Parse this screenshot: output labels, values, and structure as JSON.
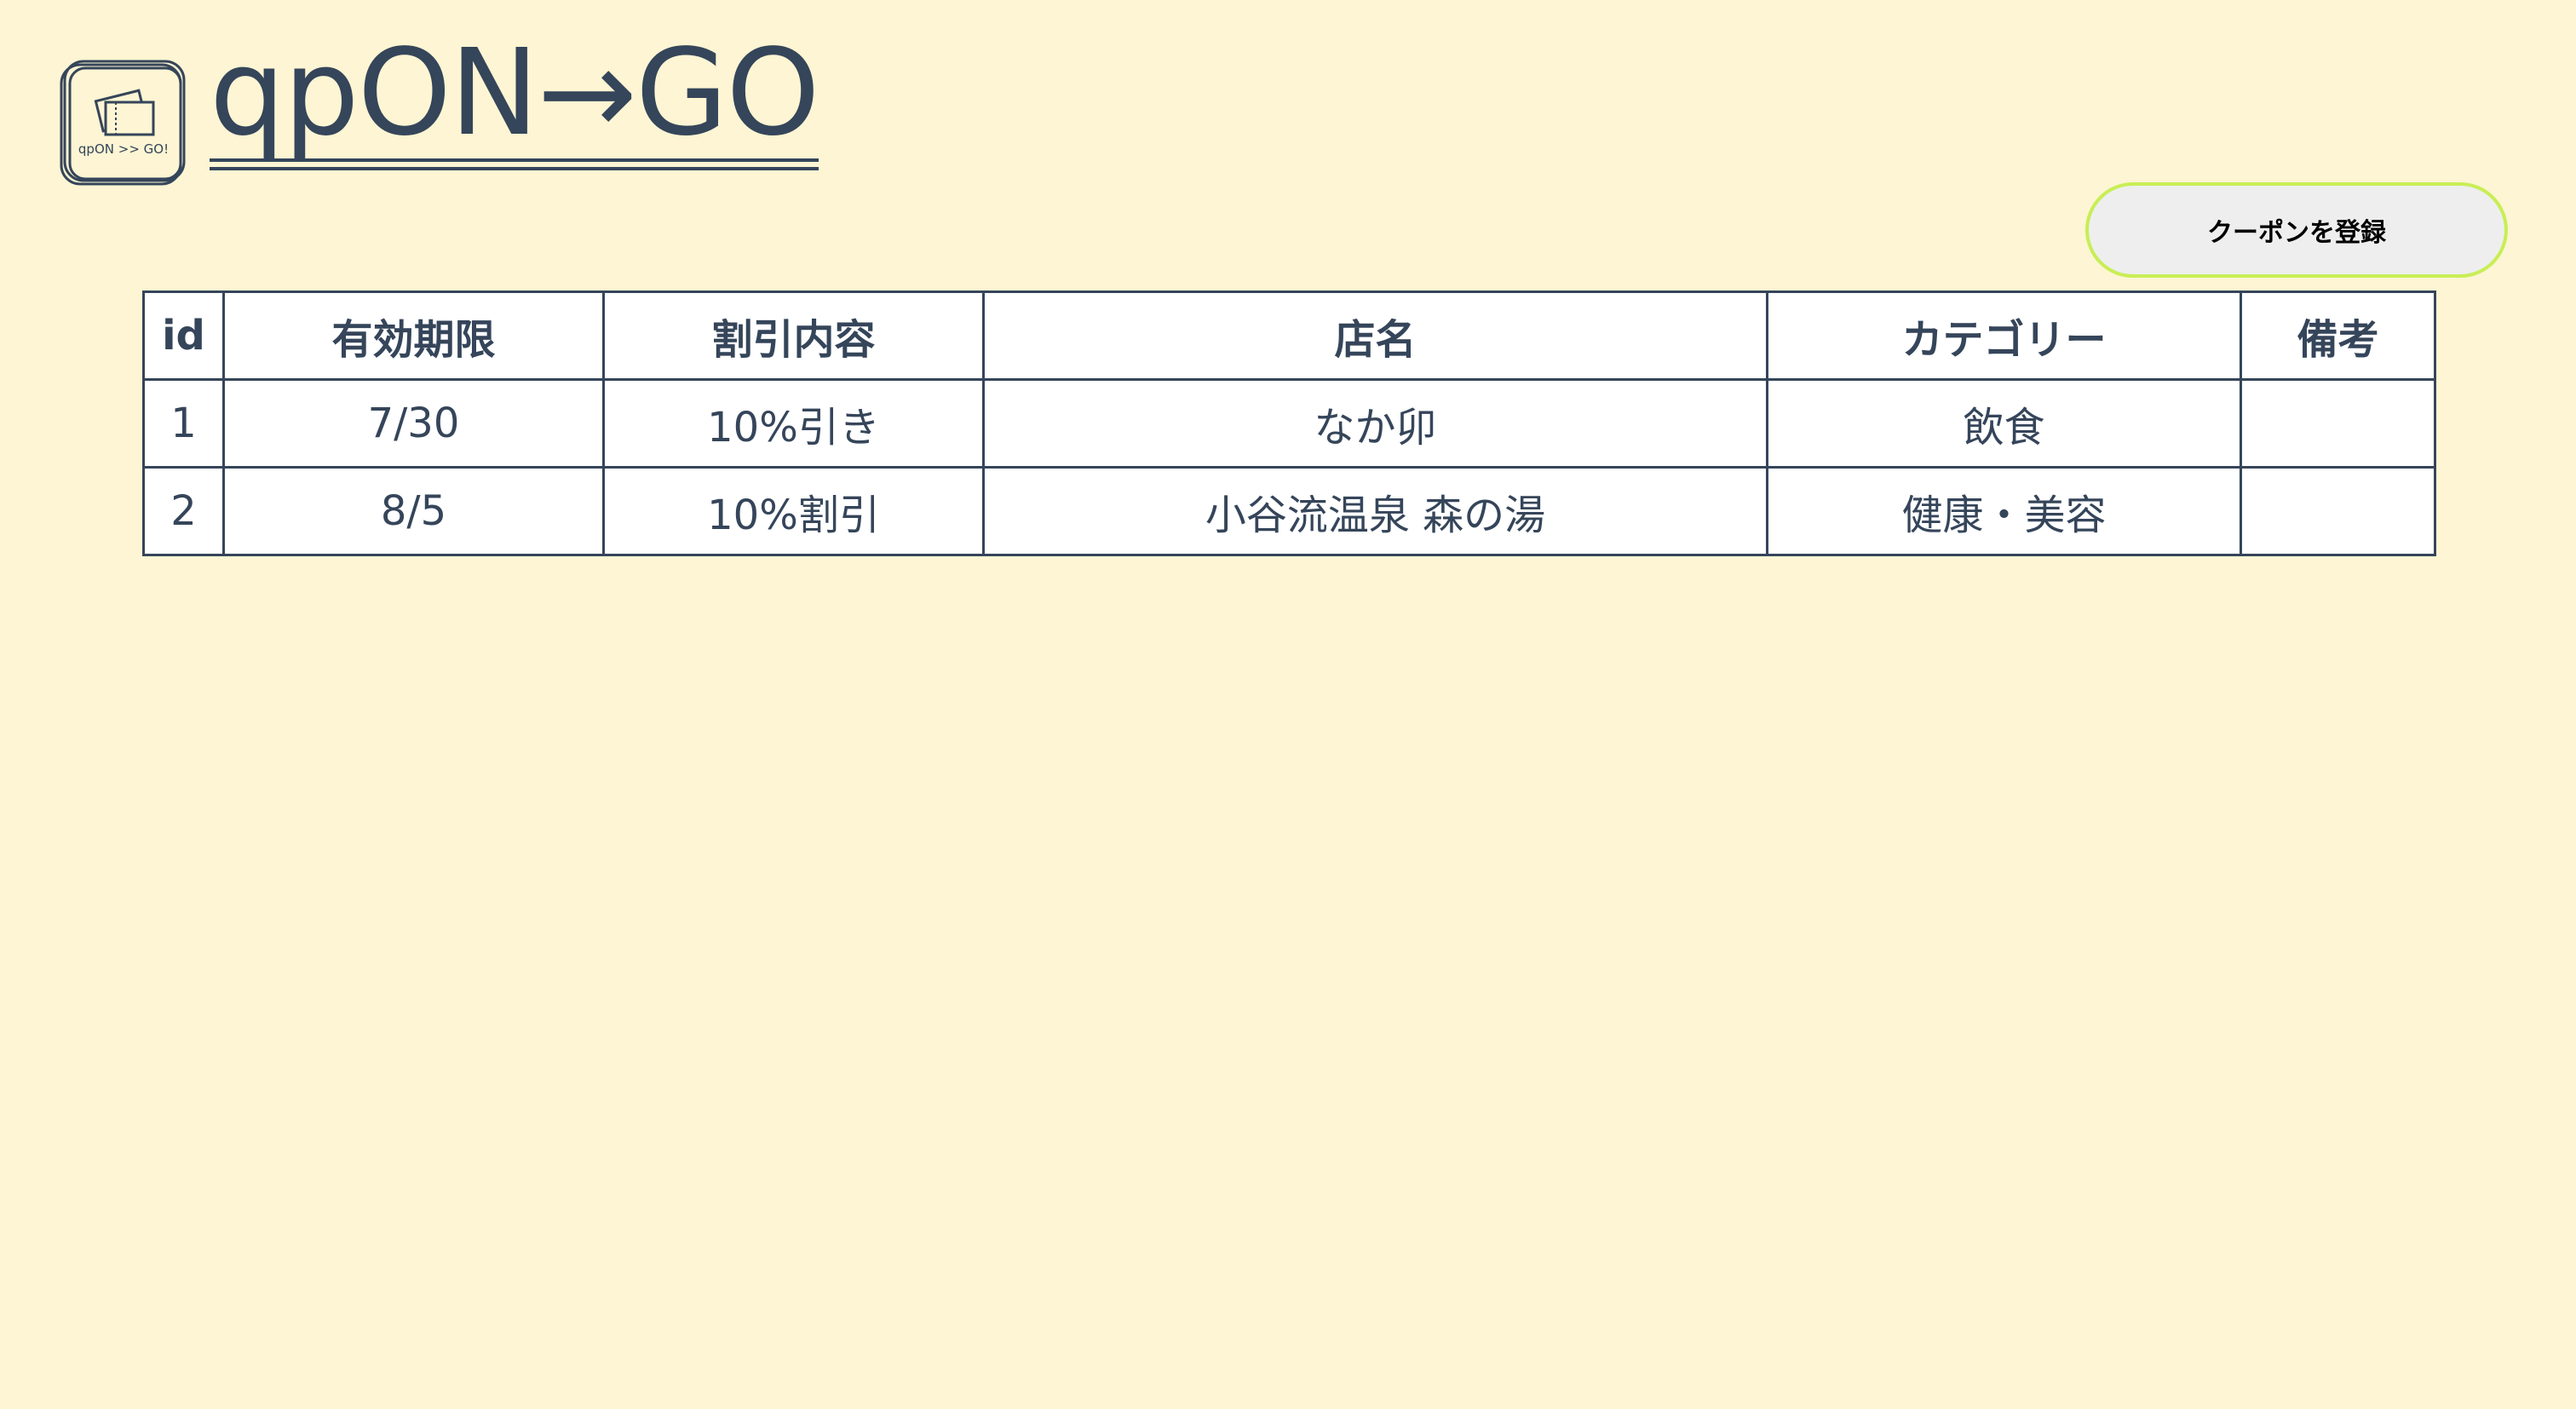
{
  "header": {
    "logo_text": "qpON >> GO!",
    "title": "qpON→GO"
  },
  "actions": {
    "register_label": "クーポンを登録"
  },
  "table": {
    "headers": [
      "id",
      "有効期限",
      "割引内容",
      "店名",
      "カテゴリー",
      "備考"
    ],
    "rows": [
      [
        "1",
        "7/30",
        "10%引き",
        "なか卯",
        "飲食",
        ""
      ],
      [
        "2",
        "8/5",
        "10%割引",
        "小谷流温泉 森の湯",
        "健康・美容",
        ""
      ]
    ]
  },
  "colors": {
    "background": "#fdf5d3",
    "text": "#35455a",
    "button_border": "#c8ee55",
    "button_bg": "#eeeeee"
  }
}
